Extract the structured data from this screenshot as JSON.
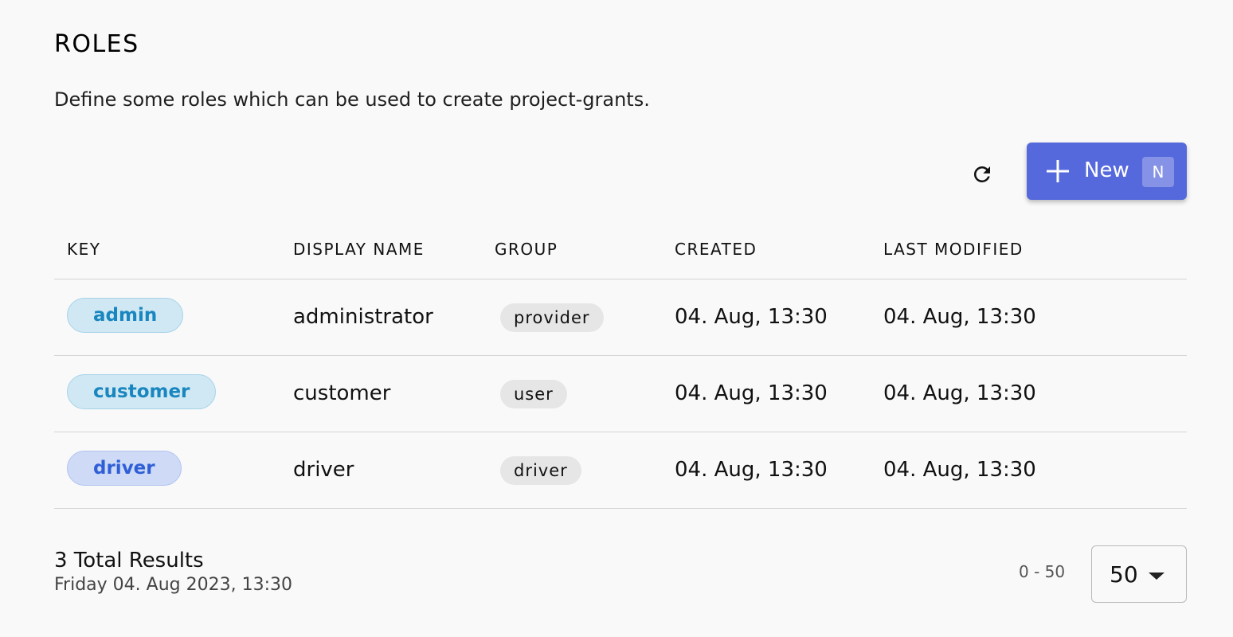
{
  "header": {
    "title": "ROLES",
    "description": "Define some roles which can be used to create project-grants."
  },
  "toolbar": {
    "refresh_icon": "refresh-icon",
    "new_icon": "plus-icon",
    "new_label": "New",
    "new_shortcut": "N",
    "new_button_color": "#5669dc"
  },
  "table": {
    "columns": [
      "KEY",
      "DISPLAY NAME",
      "GROUP",
      "CREATED",
      "LAST MODIFIED"
    ],
    "rows": [
      {
        "key": "admin",
        "key_chip_bg": "#cfe8f3",
        "key_chip_border": "#a8d3ea",
        "key_chip_text": "#1a86bf",
        "display_name": "administrator",
        "group": "provider",
        "created": "04. Aug, 13:30",
        "last_modified": "04. Aug, 13:30"
      },
      {
        "key": "customer",
        "key_chip_bg": "#cfe8f3",
        "key_chip_border": "#a8d3ea",
        "key_chip_text": "#1a86bf",
        "display_name": "customer",
        "group": "user",
        "created": "04. Aug, 13:30",
        "last_modified": "04. Aug, 13:30"
      },
      {
        "key": "driver",
        "key_chip_bg": "#cfdaf7",
        "key_chip_border": "#b0c3ef",
        "key_chip_text": "#2f5fd6",
        "display_name": "driver",
        "group": "driver",
        "created": "04. Aug, 13:30",
        "last_modified": "04. Aug, 13:30"
      }
    ]
  },
  "footer": {
    "total_results": "3 Total Results",
    "timestamp": "Friday 04. Aug 2023, 13:30",
    "range": "0 - 50",
    "page_size": "50",
    "page_size_icon": "caret-down-icon"
  }
}
